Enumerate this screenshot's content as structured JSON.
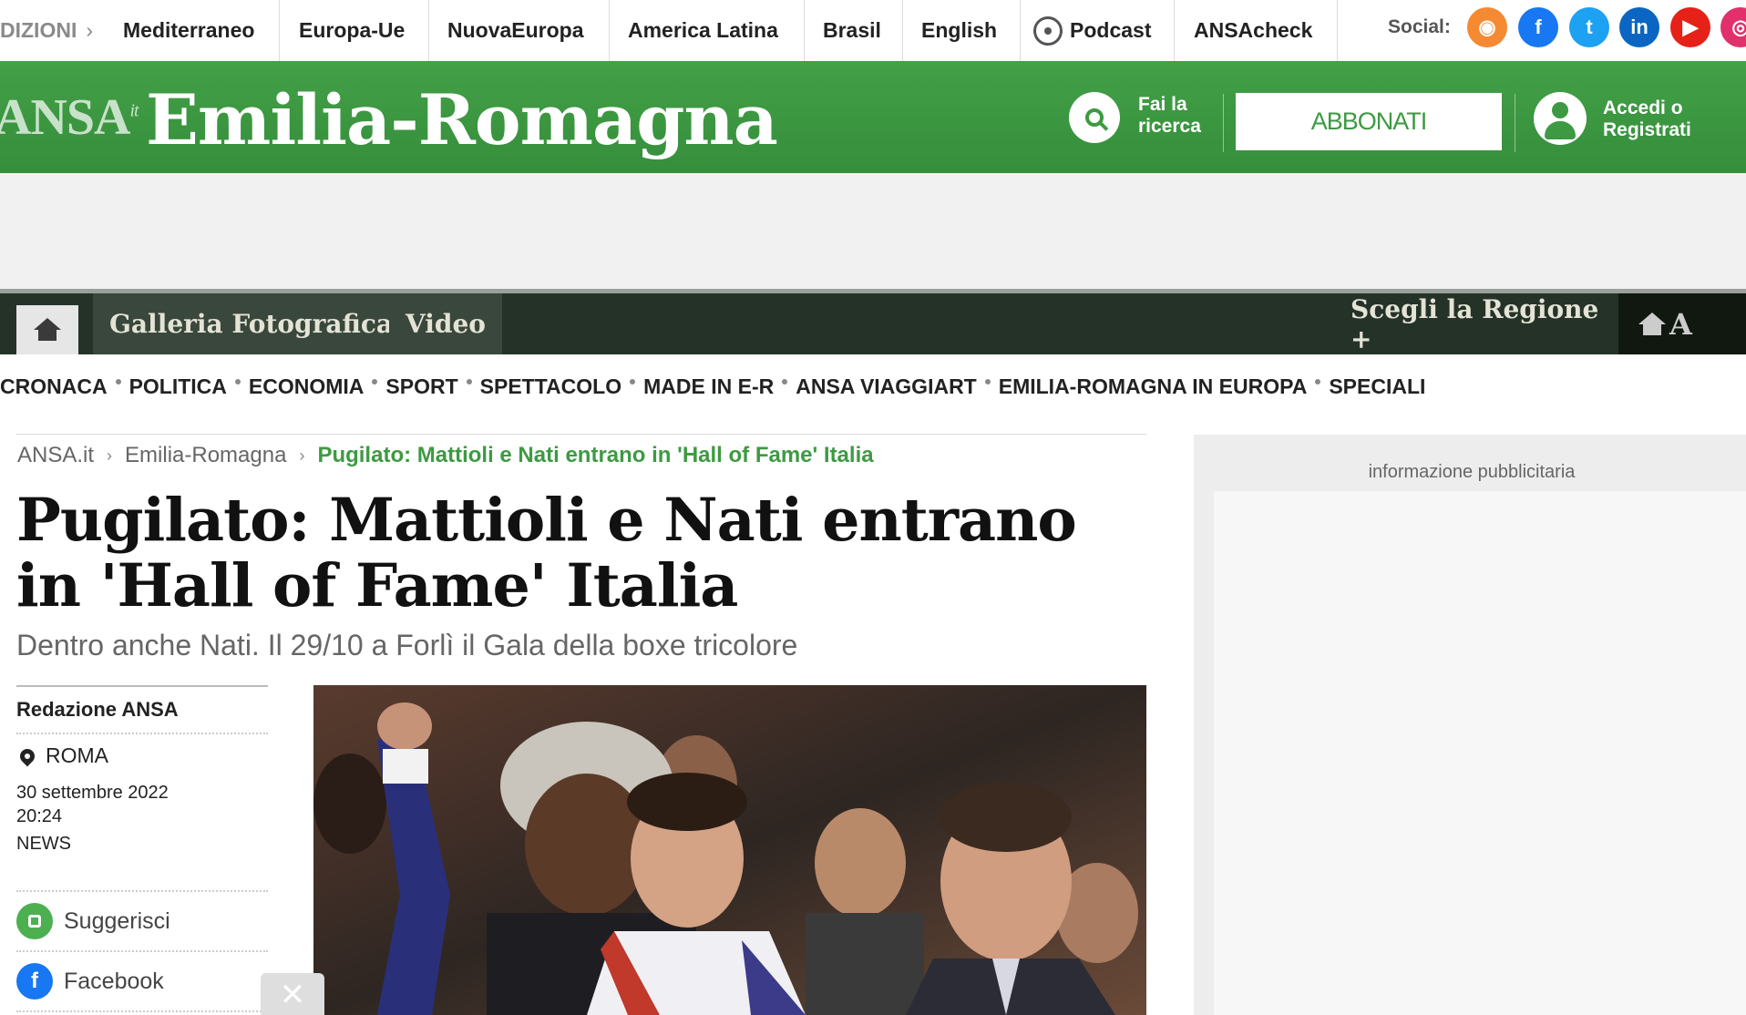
{
  "editions": [
    {
      "id": "edizioni",
      "label": "DIZIONI",
      "chevron": "›"
    },
    {
      "id": "mediterraneo",
      "label": "Mediterraneo"
    },
    {
      "id": "europa-ue",
      "label": "Europa-Ue"
    },
    {
      "id": "nuovaeuropa",
      "label": "NuovaEuropa"
    },
    {
      "id": "america-latina",
      "label": "America Latina"
    },
    {
      "id": "brasil",
      "label": "Brasil"
    },
    {
      "id": "english",
      "label": "English"
    },
    {
      "id": "podcast",
      "label": "Podcast",
      "icon": "podcast-icon"
    },
    {
      "id": "ansacheck",
      "label": "ANSAcheck"
    }
  ],
  "social": {
    "label": "Social:",
    "icons": [
      {
        "name": "rss-icon",
        "glyph": "◉",
        "color": "#f58a33"
      },
      {
        "name": "facebook-icon",
        "glyph": "f",
        "color": "#1877f2"
      },
      {
        "name": "twitter-icon",
        "glyph": "t",
        "color": "#1da1f2"
      },
      {
        "name": "linkedin-icon",
        "glyph": "in",
        "color": "#0a66c2"
      },
      {
        "name": "youtube-icon",
        "glyph": "▶",
        "color": "#e62117"
      },
      {
        "name": "instagram-icon",
        "glyph": "◎",
        "color": "#e1306c"
      }
    ]
  },
  "brand": {
    "logo": "ANSA",
    "logo_suffix": "it",
    "region": "Emilia-Romagna",
    "search_label": "Fai la ricerca",
    "subscribe_label": "ABBONATI",
    "login_label": "Accedi o Registrati",
    "color_green": "#3d9a42"
  },
  "nav": {
    "tabs": [
      "Galleria Fotografica",
      "Video"
    ],
    "choose_region": "Scegli la Regione +",
    "font_tool_letter": "A"
  },
  "sections": [
    "CRONACA",
    "POLITICA",
    "ECONOMIA",
    "SPORT",
    "SPETTACOLO",
    "MADE IN E-R",
    "ANSA VIAGGIART",
    "EMILIA-ROMAGNA IN EUROPA",
    "SPECIALI"
  ],
  "breadcrumb": {
    "items": [
      "ANSA.it",
      "Emilia-Romagna"
    ],
    "current": "Pugilato: Mattioli e Nati entrano in 'Hall of Fame' Italia"
  },
  "article": {
    "headline": "Pugilato: Mattioli e Nati entrano in 'Hall of Fame' Italia",
    "subtitle": "Dentro anche Nati. Il 29/10 a Forlì il Gala della boxe tricolore",
    "author": "Redazione ANSA",
    "place": "ROMA",
    "date": "30 settembre 2022",
    "time": "20:24",
    "kind": "NEWS"
  },
  "share": [
    {
      "name": "suggest",
      "label": "Suggerisci",
      "icon": "thumbs-up-icon",
      "color": "#4caf50"
    },
    {
      "name": "facebook",
      "label": "Facebook",
      "icon": "facebook-icon",
      "color": "#1877f2"
    }
  ],
  "ad": {
    "label": "informazione pubblicitaria",
    "close_glyph": "✕"
  }
}
